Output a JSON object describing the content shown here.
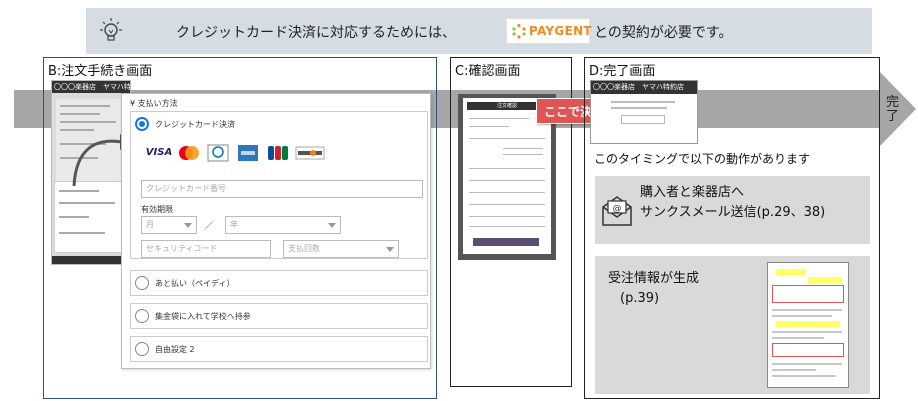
{
  "banner": {
    "text_before": "クレジットカード決済に対応するためには、",
    "paygent_logo": "PAYGENT",
    "text_after": "との契約が必要です。",
    "icon": "lightbulb-icon"
  },
  "flow": {
    "end_label": "完了"
  },
  "panels": {
    "b": {
      "title": "B:注文手続き画面"
    },
    "c": {
      "title": "C:確認画面"
    },
    "d": {
      "title": "D:完了画面"
    }
  },
  "b_screen": {
    "header": "〇〇〇楽器店　ヤマハ特約店"
  },
  "payment_form": {
    "heading": "¥ 支払い方法",
    "options": [
      {
        "label": "クレジットカード決済",
        "selected": true
      },
      {
        "label": "あと払い（ペイディ）",
        "selected": false
      },
      {
        "label": "集金袋に入れて学校へ持参",
        "selected": false
      },
      {
        "label": "自由設定 2",
        "selected": false
      }
    ],
    "card_brands": [
      "VISA",
      "Mastercard",
      "Diners Club",
      "AMERICAN EXPRESS",
      "JCB",
      "DISCOVER"
    ],
    "card_number_placeholder": "クレジットカード番号",
    "expiry_label": "有効期限",
    "month_placeholder": "月",
    "slash": "／",
    "year_placeholder": "年",
    "security_code_placeholder": "セキュリティコード",
    "installments_placeholder": "支払回数"
  },
  "c_screen": {
    "header": "注文確認",
    "callout": "ここで決済！"
  },
  "d_screen": {
    "header": "〇〇〇楽器店　ヤマハ特約店",
    "timing_text": "このタイミングで以下の動作があります",
    "box1": {
      "line1": "購入者と楽器店へ",
      "line2": "サンクスメール送信(p.29、38)"
    },
    "box2": {
      "line1": "受注情報が生成",
      "line2": "(p.39)"
    }
  },
  "colors": {
    "banner_bg": "#d6dce4",
    "flow_arrow": "#a6a6a6",
    "radio_selected": "#1a73e8",
    "callout_red": "#e05454",
    "paygent_orange": "#f08a24"
  }
}
